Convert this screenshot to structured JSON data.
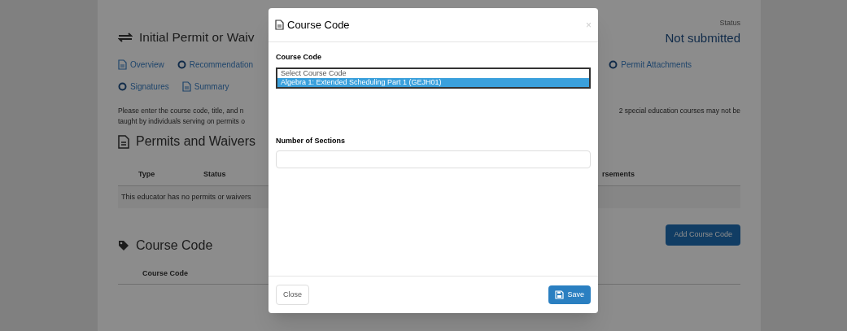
{
  "page": {
    "title": "Initial Permit or Waiv",
    "status_label": "Status",
    "status_value": "Not submitted",
    "tabs_row_1": [
      {
        "label": "Overview",
        "kind": "document"
      },
      {
        "label": "Recommendation",
        "kind": "step"
      }
    ],
    "tabs_row_1_right": [
      {
        "label": "Permit Attachments",
        "kind": "step"
      }
    ],
    "tabs_row_2": [
      {
        "label": "Signatures",
        "kind": "step"
      },
      {
        "label": "Summary",
        "kind": "document"
      }
    ],
    "instructions_left": [
      "Please enter the course code, title, and n",
      "taught by individuals serving on permits o"
    ],
    "instructions_right": "2 special education courses may not be",
    "permits_heading": "Permits and Waivers",
    "permits_columns": [
      "Type",
      "Status"
    ],
    "permits_columns_right": [
      "rsements"
    ],
    "permits_empty": "This educator has no permits or waivers",
    "course_heading": "Course Code",
    "add_button": "Add Course Code",
    "course_columns": [
      "Course Code"
    ]
  },
  "dialog": {
    "title": "Course Code",
    "close_icon": "×",
    "course_label": "Course Code",
    "options": [
      {
        "label": "Select Course Code",
        "selected": false
      },
      {
        "label": "Algebra 1: Extended Scheduling Part 1 (GEJH01)",
        "selected": true
      }
    ],
    "sections_label": "Number of Sections",
    "buttons": {
      "close": "Close",
      "save": "Save"
    }
  }
}
